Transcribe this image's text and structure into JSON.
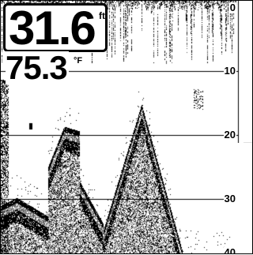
{
  "readout": {
    "depth": "31.6",
    "depth_unit": "ft",
    "temperature": "75.3",
    "temperature_unit": "°F"
  },
  "depth_scale": {
    "labels": [
      "0",
      "10",
      "20",
      "30",
      "40"
    ]
  },
  "colors": {
    "background": "#ffffff",
    "returns": "#000000",
    "strong_return": "#111111",
    "grid": "#000000"
  }
}
